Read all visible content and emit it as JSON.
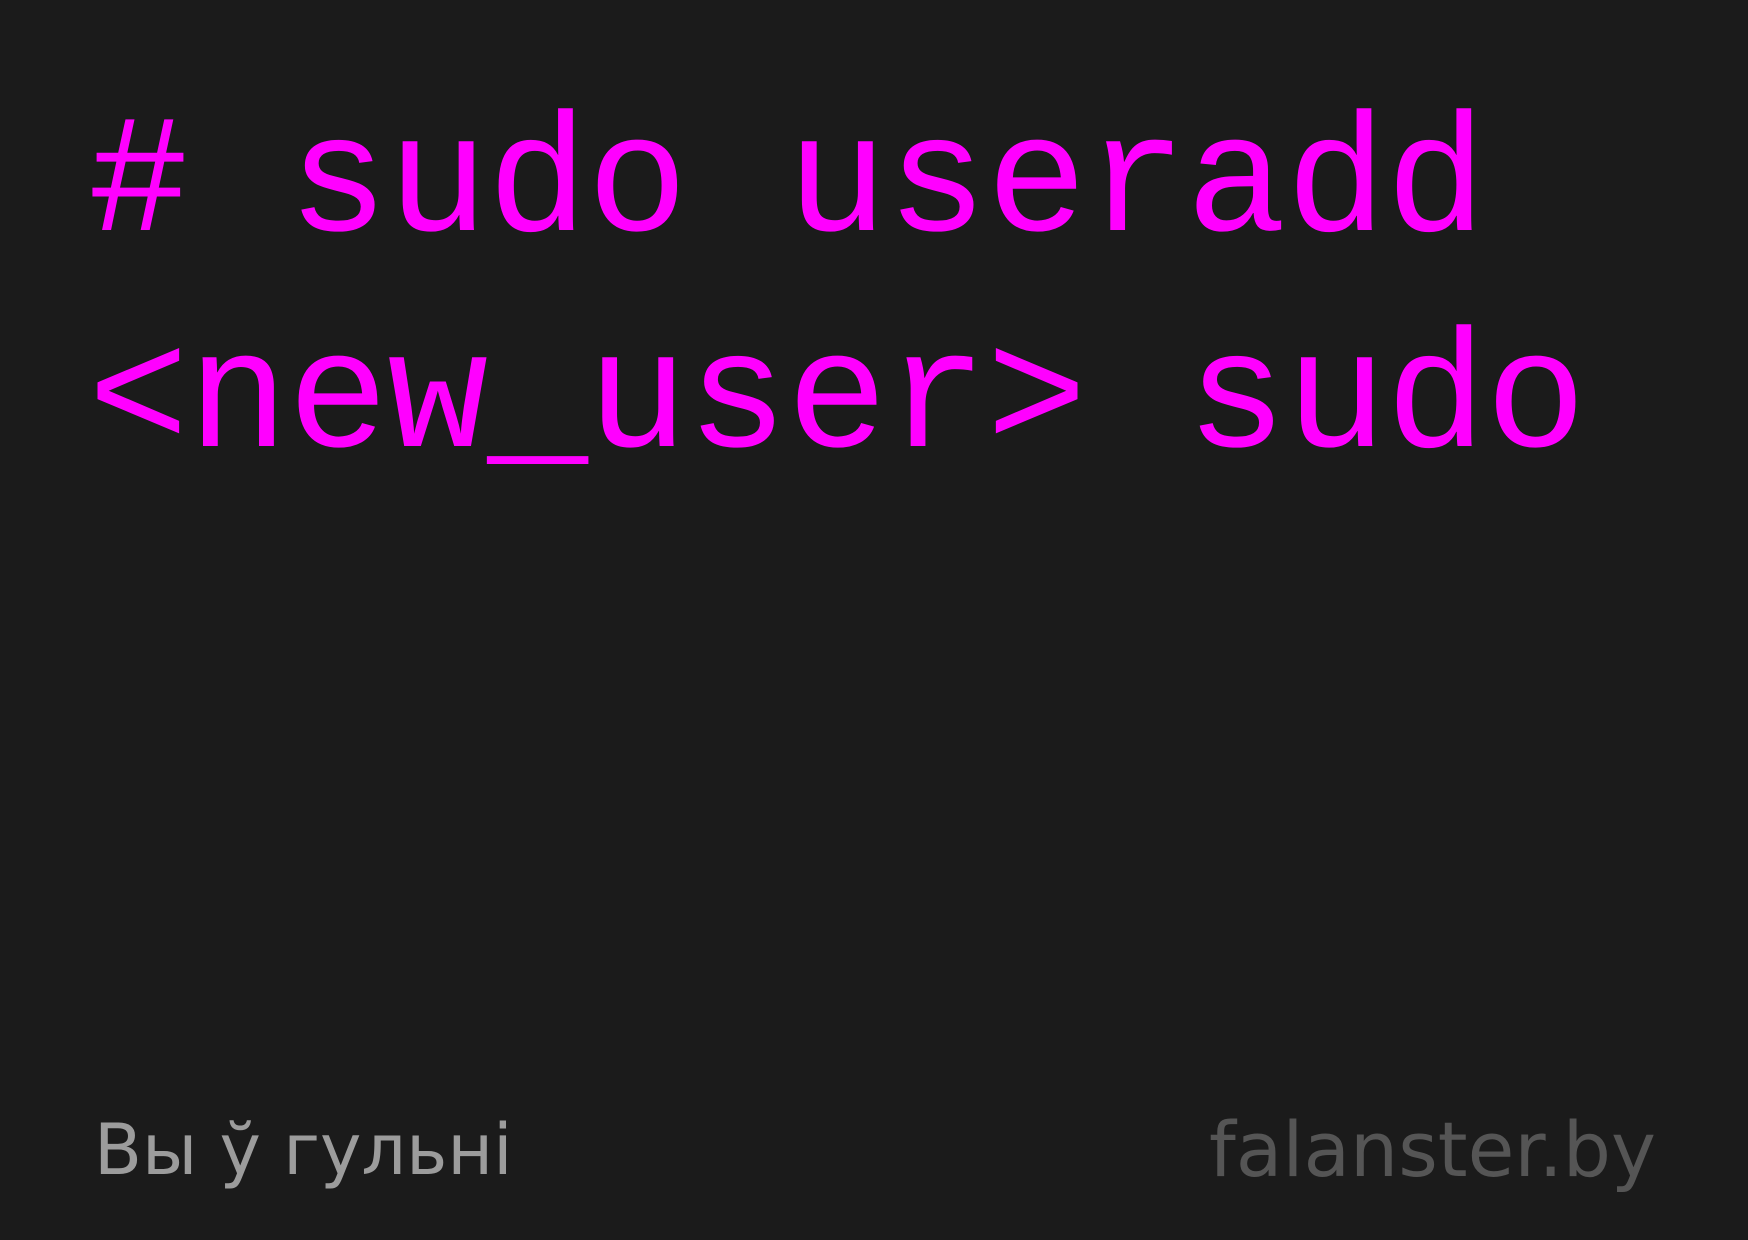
{
  "command": {
    "line1": "# sudo useradd",
    "line2": "<new_user> sudo"
  },
  "footer": {
    "tagline": "Вы ў гульні",
    "site": "falanster.by"
  },
  "colors": {
    "background": "#1b1b1b",
    "command_text": "#ff00ff",
    "tagline_text": "#9c9c9c",
    "site_text": "#555555"
  }
}
